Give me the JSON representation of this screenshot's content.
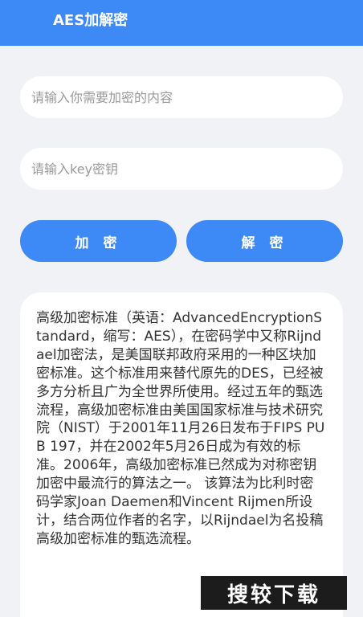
{
  "app_bar": {
    "title": "AES加解密"
  },
  "inputs": {
    "content_placeholder": "请输入你需要加密的内容",
    "key_placeholder": "请输入key密钥"
  },
  "buttons": {
    "encrypt": "加 密",
    "decrypt": "解 密"
  },
  "result": {
    "text": "高级加密标准（英语：AdvancedEncryptionStandard，缩写：AES），在密码学中又称Rijndael加密法，是美国联邦政府采用的一种区块加密标准。这个标准用来替代原先的DES，已经被多方分析且广为全世界所使用。经过五年的甄选流程，高级加密标准由美国国家标准与技术研究院（NIST）于2001年11月26日发布于FIPS PUB 197，并在2002年5月26日成为有效的标准。2006年，高级加密标准已然成为对称密钥加密中最流行的算法之一。 该算法为比利时密码学家Joan Daemen和Vincent Rijmen所设计，结合两位作者的名字，以Rijndael为名投稿高级加密标准的甄选流程。"
  },
  "watermark": {
    "text": "搜较下载"
  },
  "colors": {
    "accent": "#3d8af7",
    "background": "#f0f2f5",
    "card": "#ffffff"
  }
}
